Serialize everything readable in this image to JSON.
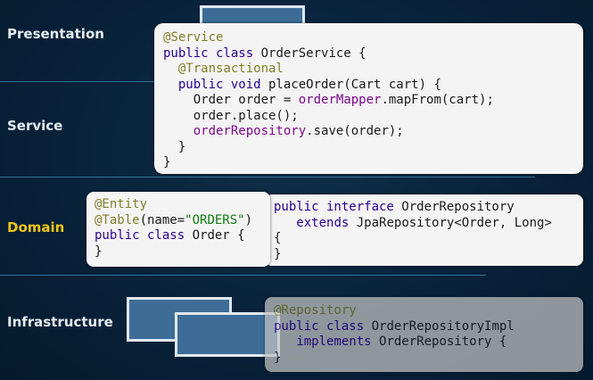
{
  "layers": {
    "presentation": "Presentation",
    "service": "Service",
    "domain": "Domain",
    "infrastructure": "Infrastructure"
  },
  "colors": {
    "background": "#08223a",
    "divider": "#3f7fa8",
    "label": "#e6edf3",
    "domain_label": "#f0c419",
    "box_fill": "#3d6d97",
    "card": "#f4f4f4",
    "keyword": "#2a008f",
    "annotation": "#7f7f2b",
    "field": "#7a0a8a",
    "string": "#117a11"
  },
  "service_code": {
    "l1_ann": "@Service",
    "l2_kw": "public class",
    "l2_rest": " OrderService {",
    "l3_ann": "@Transactional",
    "l4_kw": "public void",
    "l4_rest": " placeOrder(Cart cart) {",
    "l5_a": "Order order = ",
    "l5_fld": "orderMapper",
    "l5_b": ".mapFrom(cart);",
    "l6": "order.place();",
    "l7_fld": "orderRepository",
    "l7_b": ".save(order);",
    "l8": "}",
    "l9": "}"
  },
  "entity_code": {
    "l1_ann": "@Entity",
    "l2_ann": "@Table",
    "l2_a": "(name=",
    "l2_str": "\"ORDERS\"",
    "l2_b": ")",
    "l3_kw": "public class",
    "l3_rest": " Order {",
    "l4": "}"
  },
  "repository_code": {
    "l1_kw": "public interface",
    "l1_rest": " OrderRepository",
    "l2_kw": "extends",
    "l2_rest": " JpaRepository<Order, Long>",
    "l3": "{",
    "l4": "}"
  },
  "impl_code": {
    "l1_ann": "@Repository",
    "l2_kw": "public class",
    "l2_rest": " OrderRepositoryImpl",
    "l3_kw": "implements",
    "l3_rest": " OrderRepository {",
    "l4": "}"
  }
}
